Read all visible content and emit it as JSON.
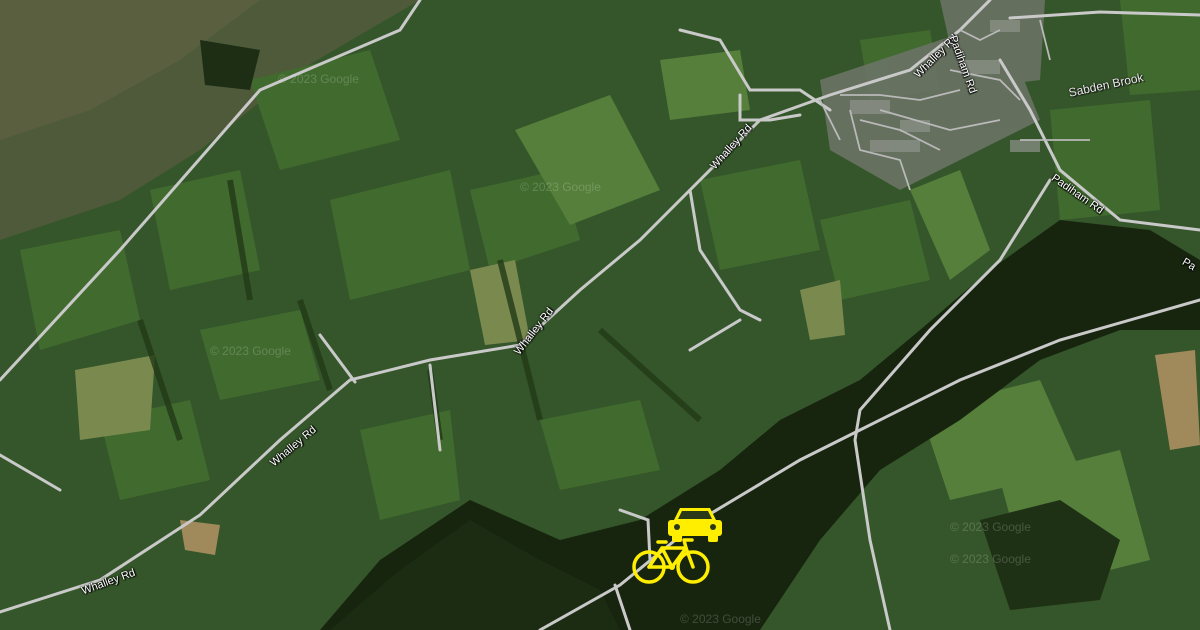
{
  "map": {
    "style": "satellite",
    "road_labels": {
      "whalley_1": "Whalley Rd",
      "whalley_2": "Whalley Rd",
      "whalley_3": "Whalley Rd",
      "whalley_4": "Whalley Rd",
      "whalley_5": "Whalley Rd",
      "padiham_1": "Padiham Rd",
      "padiham_2": "Padiham Rd",
      "padiham_3": "Pa"
    },
    "feature_labels": {
      "sabden_brook": "Sabden Brook"
    },
    "watermark": "© 2023 Google",
    "markers": [
      {
        "type": "car",
        "icon": "car-icon",
        "color": "#ffee00"
      },
      {
        "type": "bicycle",
        "icon": "bicycle-icon",
        "color": "#ffee00"
      }
    ],
    "colors": {
      "road": "#c8c8c8",
      "marker": "#ffee00",
      "forest": "#16240f",
      "field": "#3f6a2c"
    }
  }
}
